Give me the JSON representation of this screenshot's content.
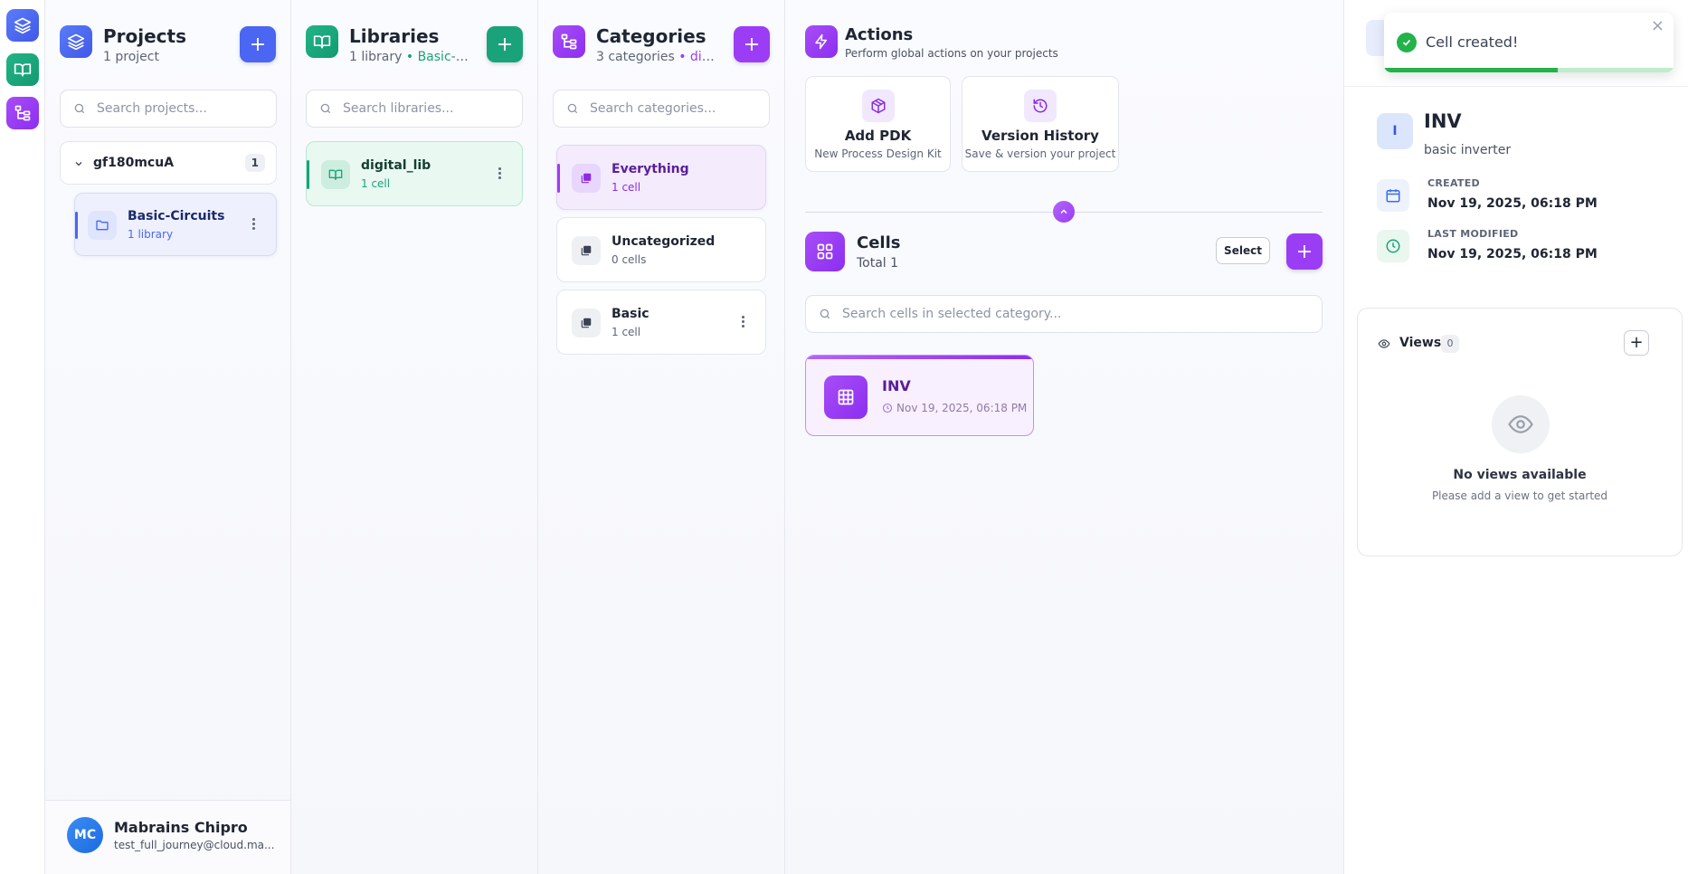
{
  "colors": {
    "blue": "#4f6bf5",
    "green": "#1aa37a",
    "purple": "#9b3df5",
    "toast_green": "#22b34a"
  },
  "rail": {
    "items": [
      {
        "icon": "layers-icon"
      },
      {
        "icon": "book-open-icon"
      },
      {
        "icon": "hierarchy-icon"
      }
    ]
  },
  "projects": {
    "title": "Projects",
    "subtitle": "1 project",
    "add_label": "+",
    "search_placeholder": "Search projects...",
    "group": {
      "name": "gf180mcuA",
      "count": "1"
    },
    "items": [
      {
        "name": "Basic-Circuits",
        "sub": "1 library"
      }
    ]
  },
  "libraries": {
    "title": "Libraries",
    "subtitle_count": "1 library",
    "subtitle_sep": " • ",
    "subtitle_ctx": "Basic-Cir...",
    "add_label": "+",
    "search_placeholder": "Search libraries...",
    "items": [
      {
        "name": "digital_lib",
        "sub": "1 cell"
      }
    ]
  },
  "categories": {
    "title": "Categories",
    "subtitle_count": "3 categories",
    "subtitle_sep": " • ",
    "subtitle_ctx": "digit...",
    "add_label": "+",
    "search_placeholder": "Search categories...",
    "items": [
      {
        "name": "Everything",
        "sub": "1 cell"
      },
      {
        "name": "Uncategorized",
        "sub": "0 cells"
      },
      {
        "name": "Basic",
        "sub": "1 cell"
      }
    ]
  },
  "actions": {
    "title": "Actions",
    "subtitle": "Perform global actions on your projects",
    "cards": [
      {
        "title": "Add PDK",
        "sub": "New Process Design Kit",
        "icon": "package-icon"
      },
      {
        "title": "Version History",
        "sub": "Save & version your project",
        "icon": "history-icon"
      }
    ]
  },
  "cells": {
    "title": "Cells",
    "subtitle": "Total 1",
    "select_label": "Select",
    "add_label": "+",
    "search_placeholder": "Search cells in selected category...",
    "items": [
      {
        "name": "INV",
        "date": "Nov 19, 2025, 06:18 PM"
      }
    ]
  },
  "detail": {
    "avatar": "I",
    "name": "INV",
    "description": "basic inverter",
    "created_label": "CREATED",
    "created_value": "Nov 19, 2025, 06:18 PM",
    "modified_label": "LAST MODIFIED",
    "modified_value": "Nov 19, 2025, 06:18 PM",
    "views_label": "Views",
    "views_count": "0",
    "views_add": "+",
    "empty_title": "No views available",
    "empty_sub": "Please add a view to get started"
  },
  "toast": {
    "message": "Cell created!",
    "close": "×",
    "progress": 0.6
  },
  "user": {
    "initials": "MC",
    "name": "Mabrains Chipro",
    "email": "test_full_journey@cloud.ma..."
  }
}
